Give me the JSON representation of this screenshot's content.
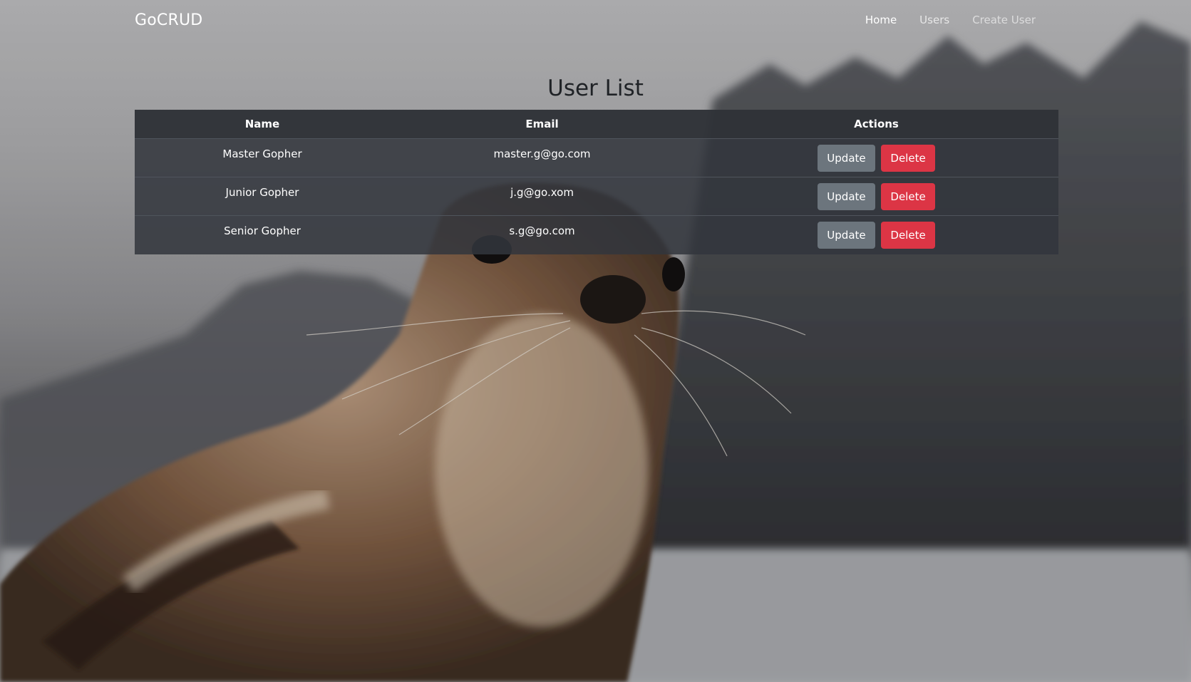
{
  "navbar": {
    "brand": "GoCRUD",
    "links": [
      {
        "label": "Home"
      },
      {
        "label": "Users"
      },
      {
        "label": "Create User"
      }
    ]
  },
  "page": {
    "title": "User List"
  },
  "table": {
    "headers": {
      "name": "Name",
      "email": "Email",
      "actions": "Actions"
    },
    "rows": [
      {
        "name": "Master Gopher",
        "email": "master.g@go.com",
        "update_label": "Update",
        "delete_label": "Delete"
      },
      {
        "name": "Junior Gopher",
        "email": "j.g@go.xom",
        "update_label": "Update",
        "delete_label": "Delete"
      },
      {
        "name": "Senior Gopher",
        "email": "s.g@go.com",
        "update_label": "Update",
        "delete_label": "Delete"
      }
    ]
  },
  "colors": {
    "update_button": "#6c757d",
    "delete_button": "#dc3545",
    "table_bg": "#343a40"
  }
}
